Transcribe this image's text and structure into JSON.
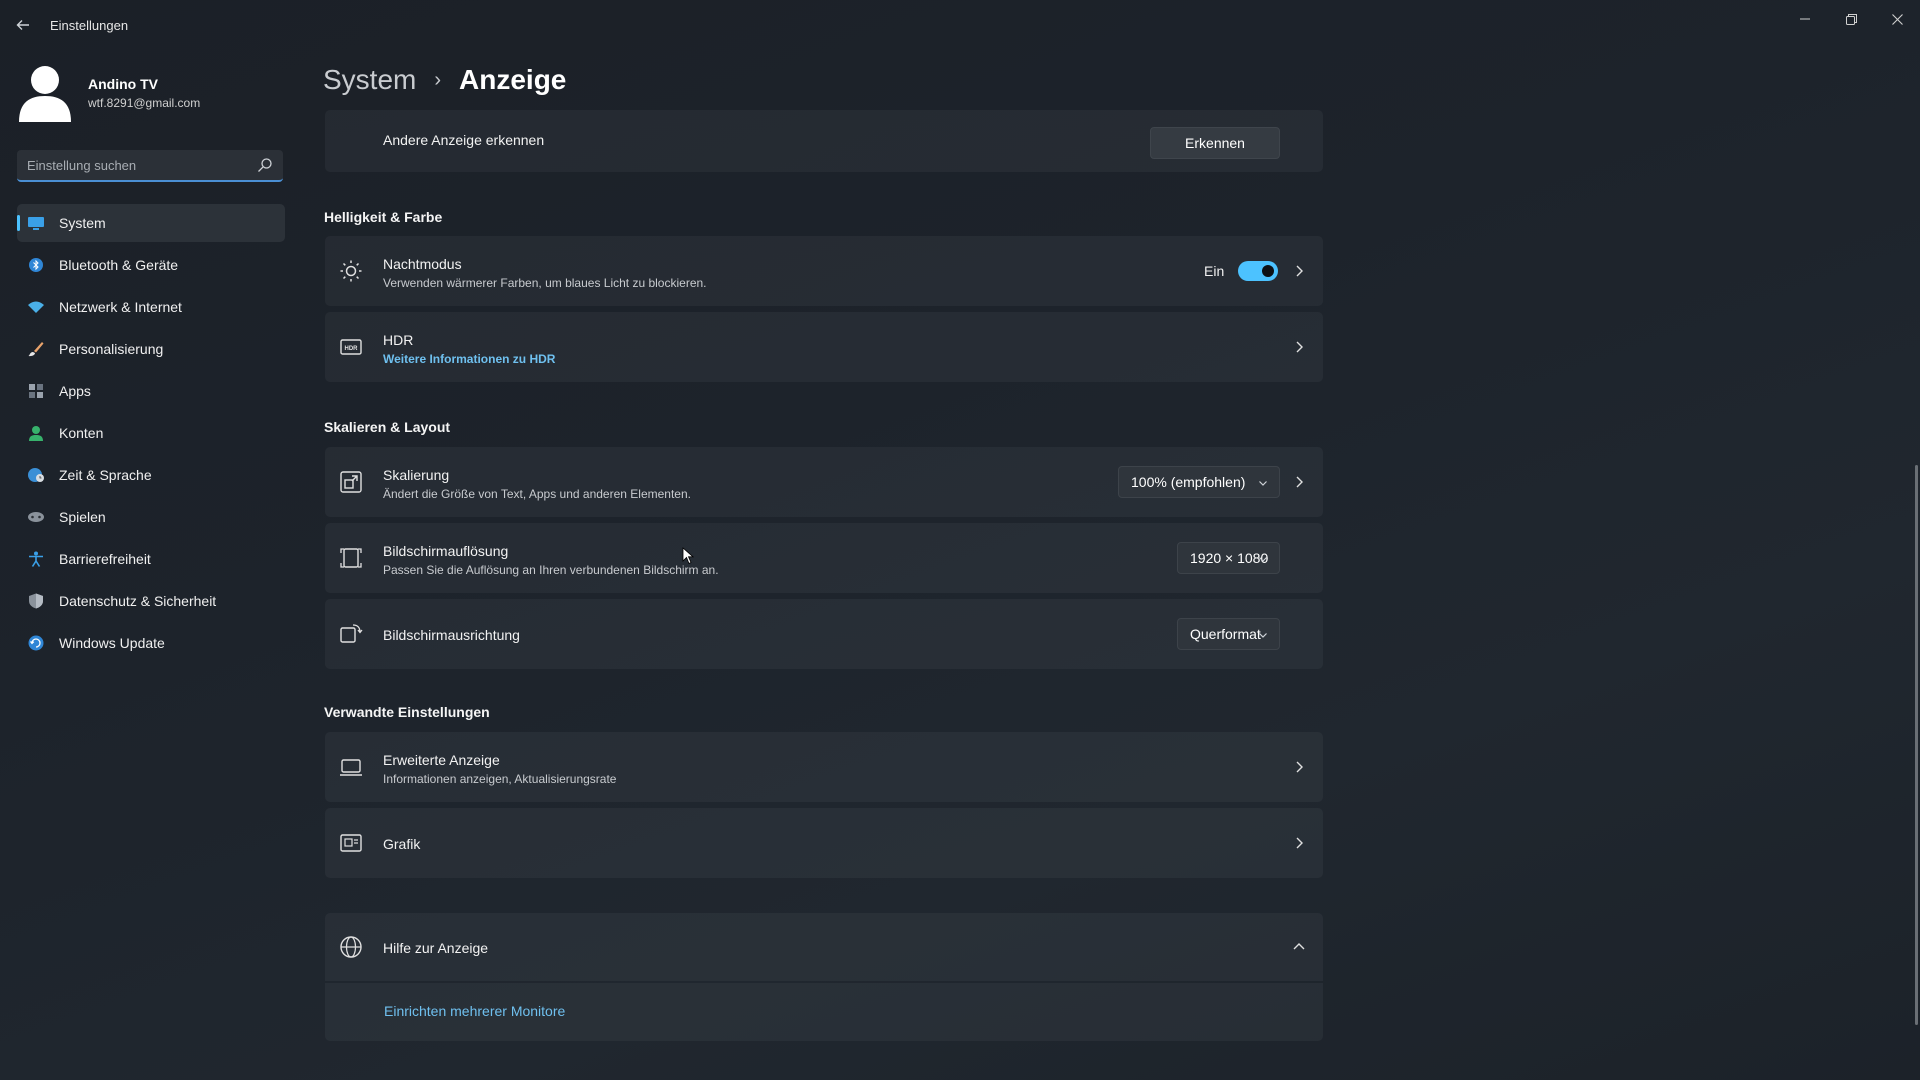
{
  "app": {
    "title": "Einstellungen"
  },
  "profile": {
    "name": "Andino TV",
    "email": "wtf.8291@gmail.com"
  },
  "search": {
    "placeholder": "Einstellung suchen"
  },
  "sidebar": {
    "items": [
      {
        "label": "System",
        "icon": "monitor-icon",
        "active": true
      },
      {
        "label": "Bluetooth & Geräte",
        "icon": "bluetooth-icon"
      },
      {
        "label": "Netzwerk & Internet",
        "icon": "wifi-icon"
      },
      {
        "label": "Personalisierung",
        "icon": "brush-icon"
      },
      {
        "label": "Apps",
        "icon": "apps-icon"
      },
      {
        "label": "Konten",
        "icon": "user-icon"
      },
      {
        "label": "Zeit & Sprache",
        "icon": "globe-clock-icon"
      },
      {
        "label": "Spielen",
        "icon": "gamepad-icon"
      },
      {
        "label": "Barrierefreiheit",
        "icon": "accessibility-icon"
      },
      {
        "label": "Datenschutz & Sicherheit",
        "icon": "shield-icon"
      },
      {
        "label": "Windows Update",
        "icon": "update-icon"
      }
    ]
  },
  "breadcrumb": {
    "parent": "System",
    "separator": "›",
    "current": "Anzeige"
  },
  "detect": {
    "label": "Andere Anzeige erkennen",
    "button": "Erkennen"
  },
  "sections": {
    "brightness": "Helligkeit & Farbe",
    "scaling": "Skalieren & Layout",
    "related": "Verwandte Einstellungen"
  },
  "nightmode": {
    "title": "Nachtmodus",
    "subtitle": "Verwenden wärmerer Farben, um blaues Licht zu blockieren.",
    "state_label": "Ein",
    "on": true
  },
  "hdr": {
    "title": "HDR",
    "link": "Weitere Informationen zu HDR"
  },
  "scale": {
    "title": "Skalierung",
    "subtitle": "Ändert die Größe von Text, Apps und anderen Elementen.",
    "value": "100% (empfohlen)"
  },
  "resolution": {
    "title": "Bildschirmauflösung",
    "subtitle": "Passen Sie die Auflösung an Ihren verbundenen Bildschirm an.",
    "value": "1920 × 1080"
  },
  "orientation": {
    "title": "Bildschirmausrichtung",
    "value": "Querformat"
  },
  "advanced": {
    "title": "Erweiterte Anzeige",
    "subtitle": "Informationen anzeigen, Aktualisierungsrate"
  },
  "graphics": {
    "title": "Grafik"
  },
  "help": {
    "title": "Hilfe zur Anzeige",
    "link": "Einrichten mehrerer Monitore"
  },
  "colors": {
    "accent": "#4cc2ff",
    "link": "#6fc0ef"
  }
}
